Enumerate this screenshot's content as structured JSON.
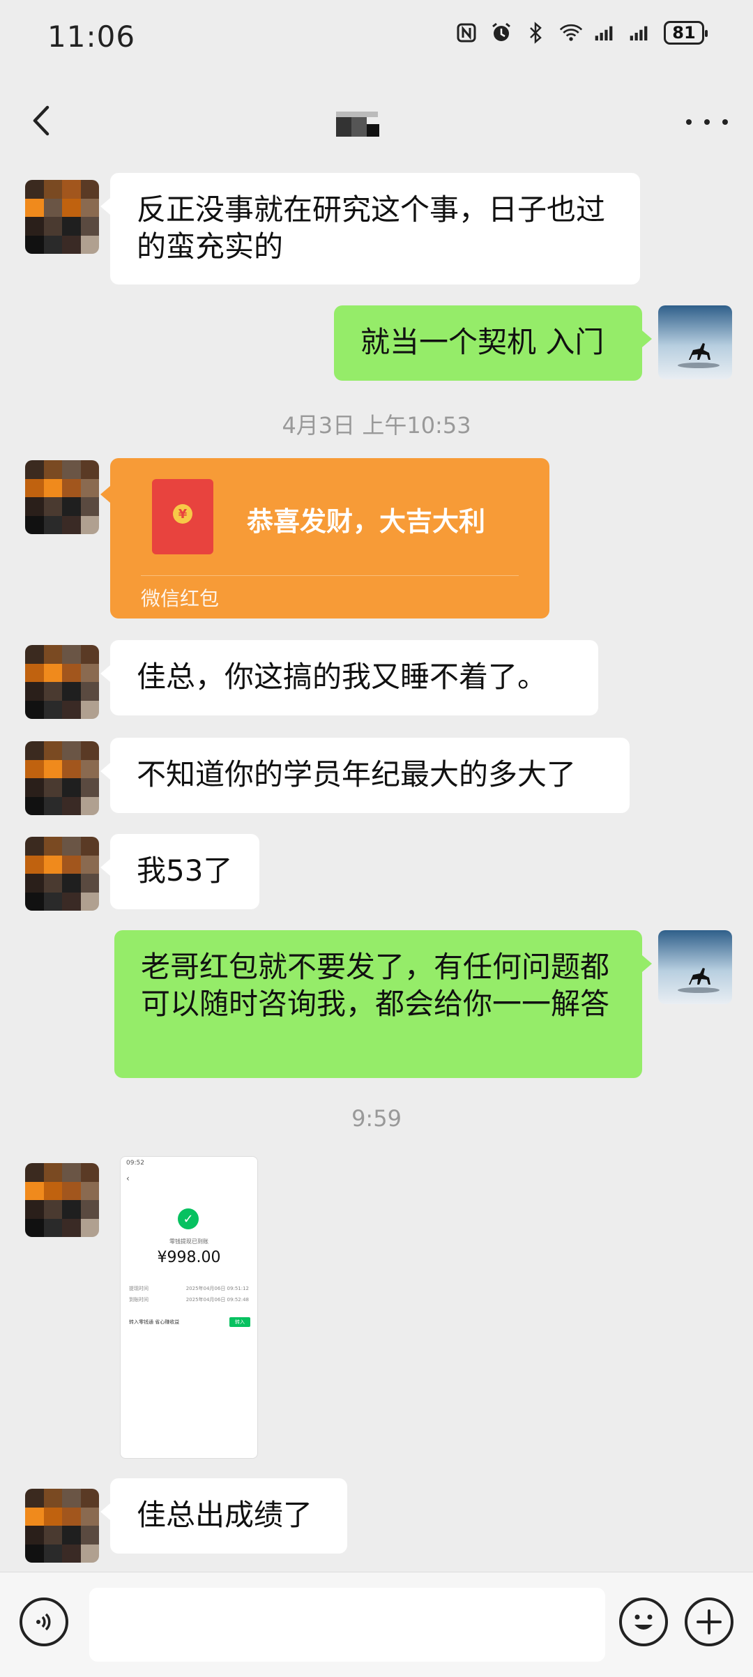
{
  "status_bar": {
    "time": "11:06",
    "battery": "81"
  },
  "header": {
    "back_icon": "back-arrow-icon",
    "more_icon": "more-dots-icon"
  },
  "messages": [
    {
      "side": "left",
      "text": "反正没事就在研究这个事，日子也过的蛮充实的"
    },
    {
      "side": "right",
      "text": "就当一个契机 入门"
    },
    {
      "timestamp": "4月3日 上午10:53"
    },
    {
      "side": "left",
      "type": "red_packet",
      "title": "恭喜发财，大吉大利",
      "label": "微信红包"
    },
    {
      "side": "left",
      "text": "佳总，你这搞的我又睡不着了。"
    },
    {
      "side": "left",
      "text": "不知道你的学员年纪最大的多大了"
    },
    {
      "side": "left",
      "text": "我53了"
    },
    {
      "side": "right",
      "text": "老哥红包就不要发了，有任何问题都可以随时咨询我，都会给你一一解答"
    },
    {
      "timestamp": "9:59"
    },
    {
      "side": "left",
      "type": "image",
      "amount": "¥998.00"
    },
    {
      "side": "left",
      "text": "佳总出成绩了"
    }
  ],
  "screenshot_thumb": {
    "status_time": "09:52",
    "amount": "¥998.00",
    "success_label": "零钱提现已到账",
    "rows": [
      {
        "label": "提现时间",
        "value": "2025年04月06日 09:51:12"
      },
      {
        "label": "到账时间",
        "value": "2025年04月06日 09:52:48"
      }
    ],
    "promo": "转入零钱通 省心赚收益",
    "promo_button": "转入"
  },
  "input_bar": {
    "voice_icon": "voice-icon",
    "emoji_icon": "emoji-icon",
    "plus_icon": "plus-icon"
  },
  "colors": {
    "background": "#ededed",
    "left_bubble": "#ffffff",
    "right_bubble": "#95ec69",
    "red_packet": "#f79b37"
  }
}
